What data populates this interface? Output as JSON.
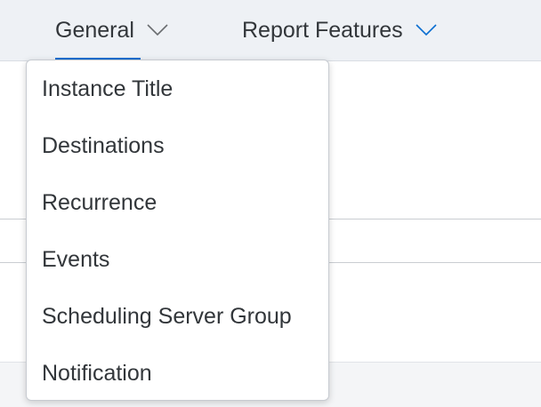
{
  "tabs": [
    {
      "label": "General",
      "icon": "chevron-down-icon",
      "selected": true
    },
    {
      "label": "Report Features",
      "icon": "chevron-down-icon",
      "selected": false
    }
  ],
  "menu": {
    "items": [
      {
        "label": "Instance Title"
      },
      {
        "label": "Destinations"
      },
      {
        "label": "Recurrence"
      },
      {
        "label": "Events"
      },
      {
        "label": "Scheduling Server Group"
      },
      {
        "label": "Notification"
      }
    ]
  },
  "colors": {
    "accent": "#0a6ed1",
    "tabbar_bg": "#eef1f5",
    "text": "#32363a"
  }
}
